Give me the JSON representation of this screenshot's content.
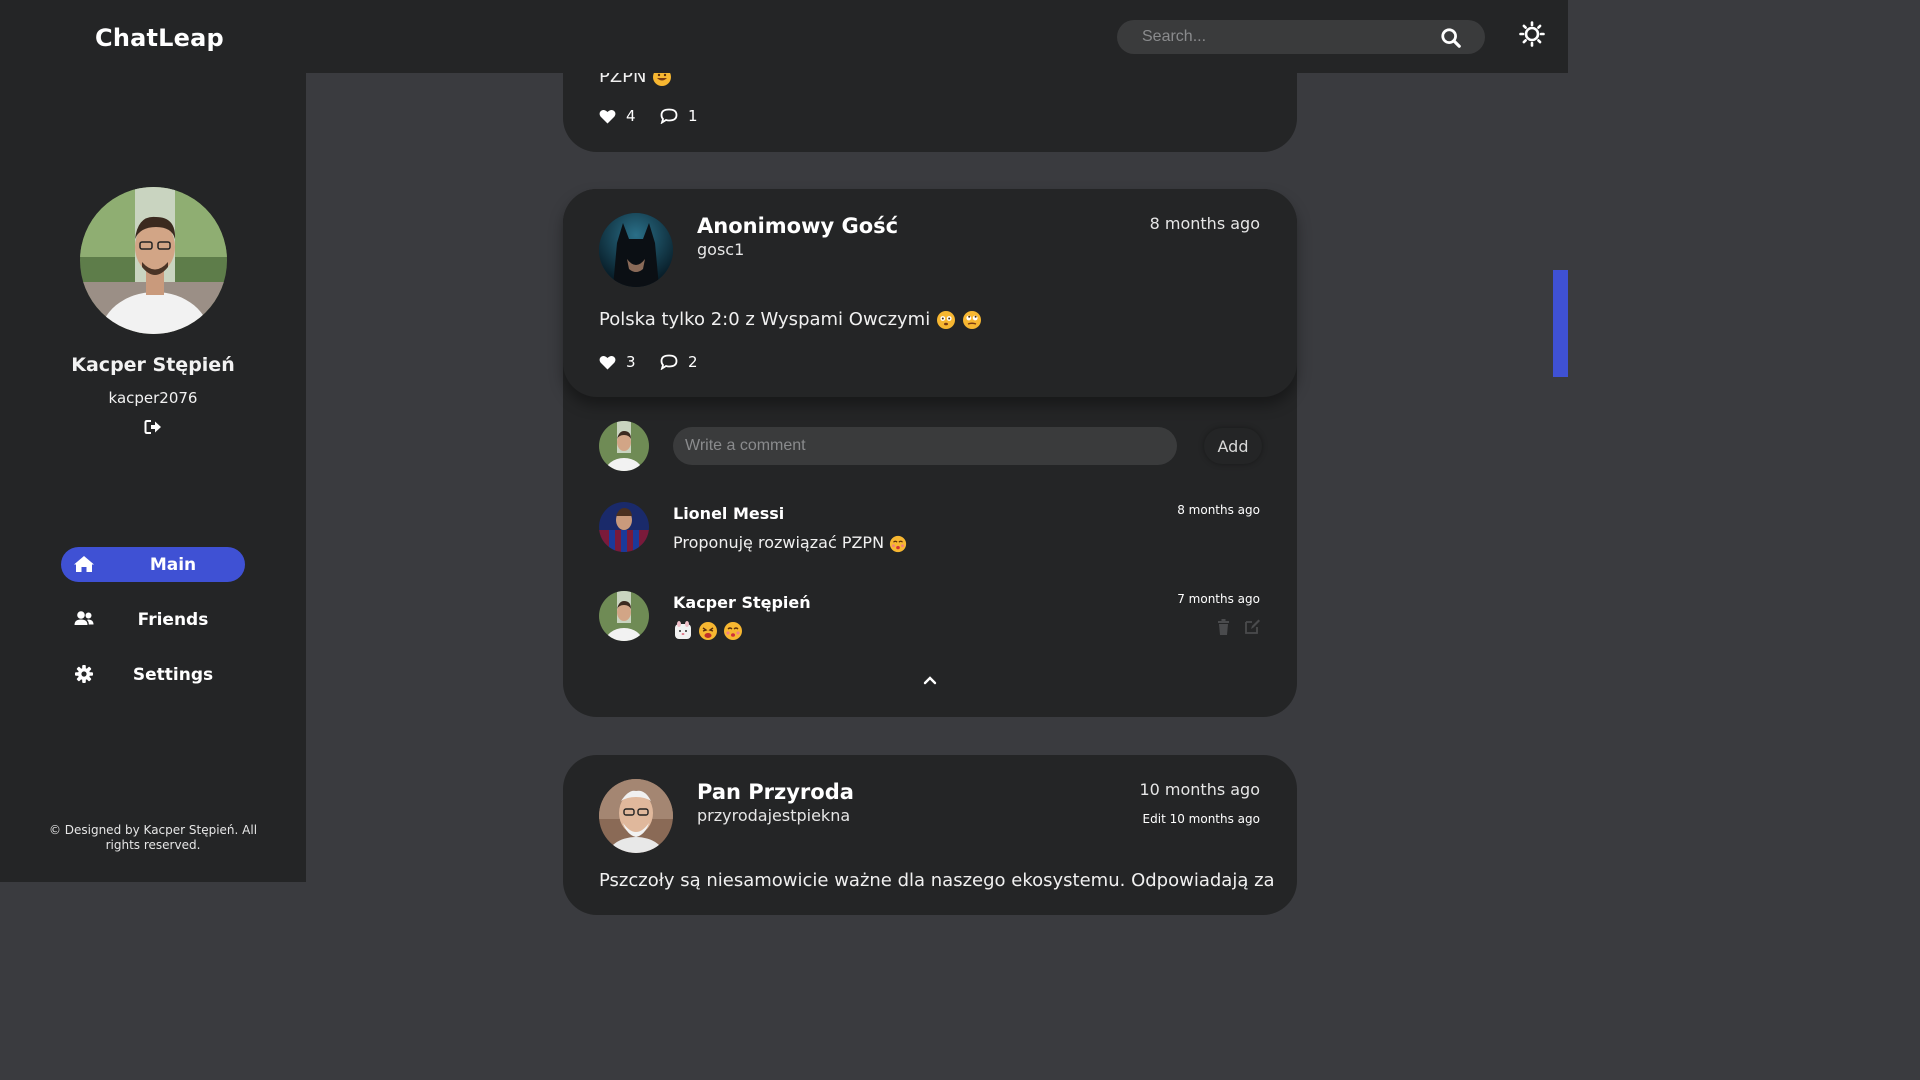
{
  "app": {
    "title": "ChatLeap"
  },
  "search": {
    "placeholder": "Search..."
  },
  "profile": {
    "name": "Kacper Stępień",
    "username": "kacper2076"
  },
  "nav": {
    "items": [
      {
        "label": "Main",
        "icon": "home-icon",
        "active": true
      },
      {
        "label": "Friends",
        "icon": "users-icon",
        "active": false
      },
      {
        "label": "Settings",
        "icon": "gear-icon",
        "active": false
      }
    ]
  },
  "footer": {
    "text": "© Designed by Kacper Stępień. All rights reserved."
  },
  "colors": {
    "accent": "#3f51d4",
    "panel": "#242526",
    "background": "#3a3b3f"
  },
  "posts": [
    {
      "text_partial": "PZPN",
      "likes": "4",
      "comments": "1"
    },
    {
      "author": "Anonimowy Gość",
      "username": "gosc1",
      "time": "8 months ago",
      "text": "Polska tylko 2:0 z Wyspami Owczymi",
      "likes": "3",
      "comments": "2",
      "comment_box": {
        "placeholder": "Write a comment",
        "add_label": "Add"
      },
      "comment_list": [
        {
          "author": "Lionel Messi",
          "time": "8 months ago",
          "text": "Proponuję rozwiązać PZPN"
        },
        {
          "author": "Kacper Stępień",
          "time": "7 months ago",
          "text": ""
        }
      ]
    },
    {
      "author": "Pan Przyroda",
      "username": "przyrodajestpiekna",
      "time": "10 months ago",
      "edit_time": "Edit 10 months ago",
      "text_partial": "Pszczoły są niesamowicie ważne dla naszego ekosystemu. Odpowiadają za"
    }
  ]
}
